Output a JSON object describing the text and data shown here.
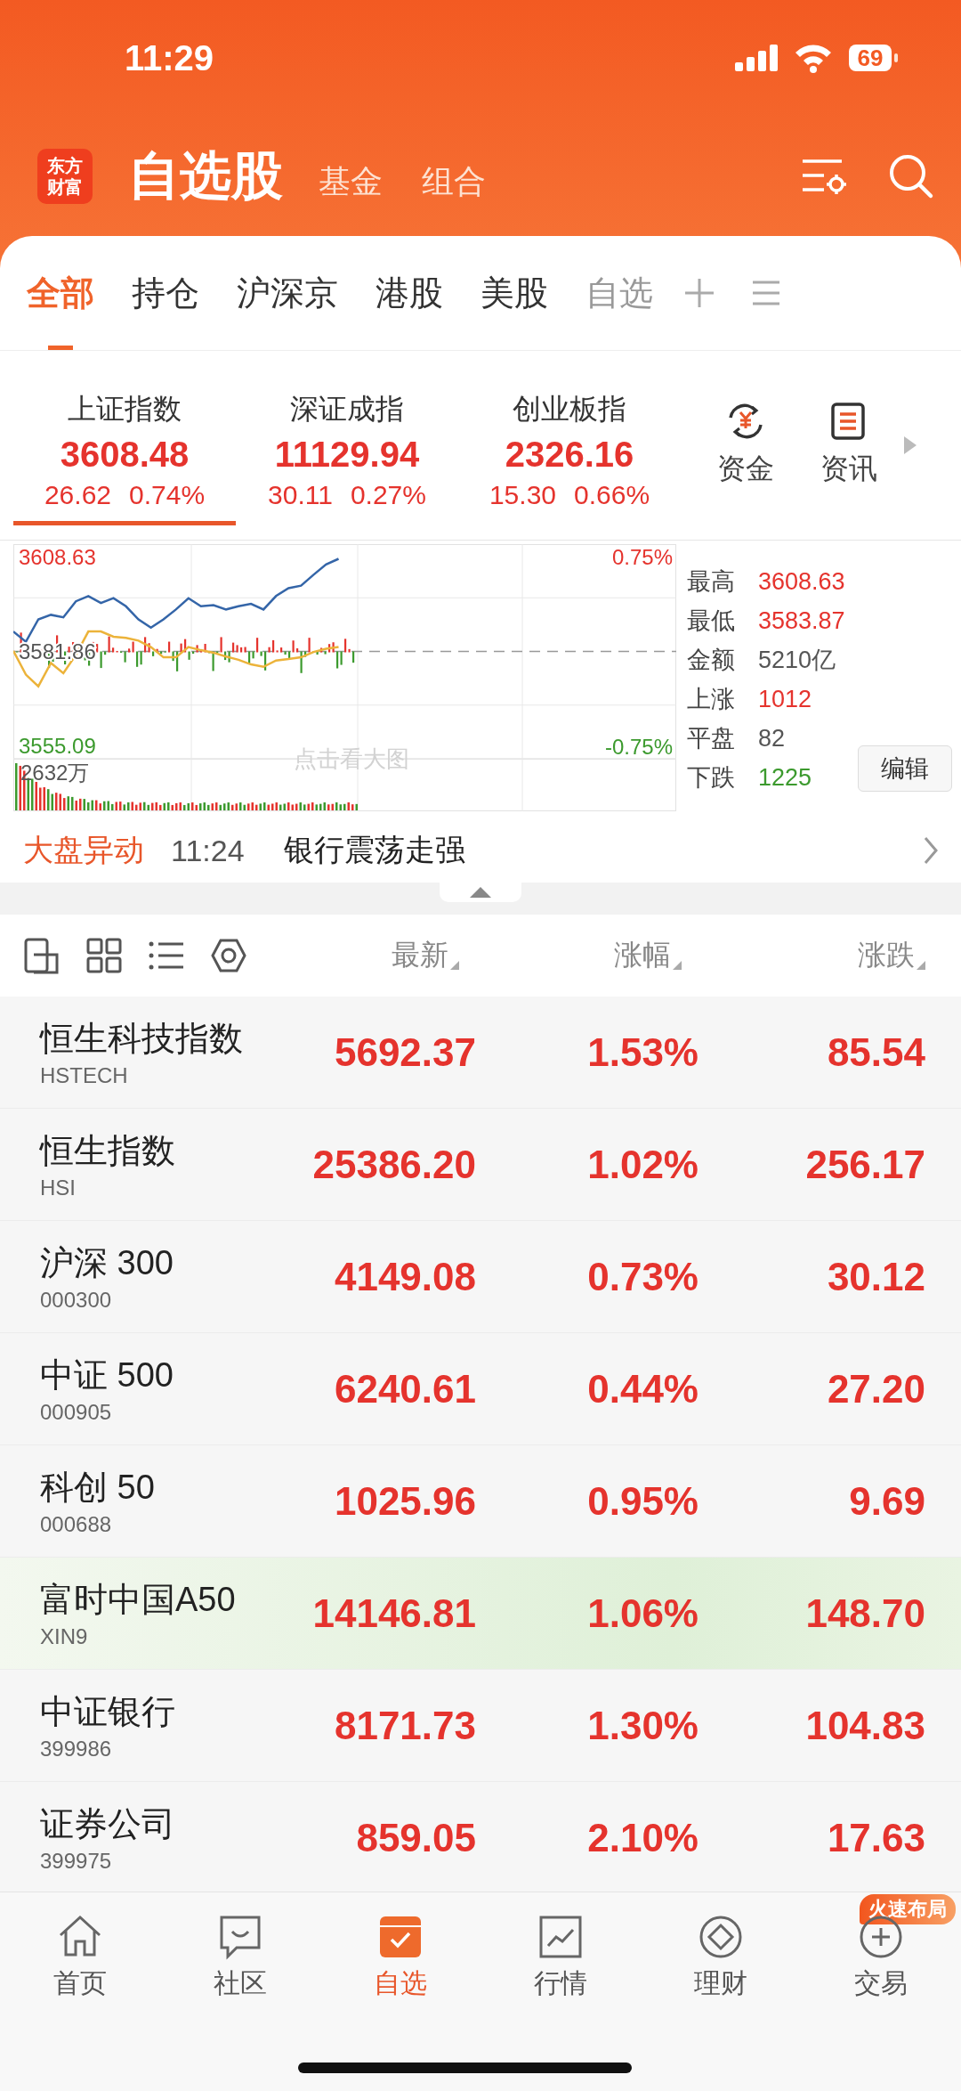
{
  "status_bar": {
    "time": "11:29",
    "battery": "69"
  },
  "header": {
    "logo": [
      "东方",
      "财富"
    ],
    "title": "自选股",
    "links": [
      {
        "label": "基金"
      },
      {
        "label": "组合"
      }
    ]
  },
  "tabs": [
    {
      "label": "全部",
      "selected": true
    },
    {
      "label": "持仓",
      "selected": false
    },
    {
      "label": "沪深京",
      "selected": false
    },
    {
      "label": "港股",
      "selected": false
    },
    {
      "label": "美股",
      "selected": false
    },
    {
      "label": "自选",
      "selected": false
    }
  ],
  "indices": [
    {
      "name": "上证指数",
      "value": "3608.48",
      "change": "26.62",
      "percent": "0.74%",
      "selected": true
    },
    {
      "name": "深证成指",
      "value": "11129.94",
      "change": "30.11",
      "percent": "0.27%",
      "selected": false
    },
    {
      "name": "创业板指",
      "value": "2326.16",
      "change": "15.30",
      "percent": "0.66%",
      "selected": false
    }
  ],
  "shortcuts": [
    {
      "label": "资金",
      "kind": "fund"
    },
    {
      "label": "资讯",
      "kind": "news"
    }
  ],
  "chart": {
    "up_percent": "0.75%",
    "down_percent": "-0.75%",
    "volume_label": "2632万",
    "hint": "点击看大图",
    "chart_data": {
      "type": "line",
      "ylim": [
        3551.57,
        3612.15
      ],
      "yticks": [
        {
          "value": 3555.09,
          "label": "3555.09"
        },
        {
          "value": 3581.86,
          "label": "3581.86"
        },
        {
          "value": 3608.63,
          "label": "3608.63"
        }
      ],
      "categories": [
        null,
        null,
        null,
        null,
        null,
        null,
        null,
        null,
        null,
        null,
        null,
        null,
        null,
        null,
        null,
        null,
        null,
        null,
        null,
        null,
        null,
        null,
        null,
        null,
        null,
        null,
        null,
        null,
        null,
        null,
        null,
        null,
        null,
        null,
        null,
        null,
        null,
        null,
        null,
        null,
        null,
        null,
        null,
        null,
        null,
        null,
        null,
        null,
        null,
        null,
        null,
        null,
        null,
        null
      ],
      "series": [
        {
          "color": "#3465a8",
          "values": [
            3587.5,
            3584.6,
            3590.9,
            3592.2,
            3591.5,
            3596.0,
            3597.5,
            3595.5,
            3596.9,
            3594.6,
            3590.9,
            3588.6,
            3590.9,
            3593.7,
            3596.9,
            3594.6,
            3594.9,
            3593.7,
            3594.6,
            3595.3,
            3593.7,
            3597.5,
            3599.7,
            3600.4,
            3603.5,
            3606.4,
            3608.0,
            null,
            null,
            null,
            null,
            null,
            null,
            null,
            null,
            null,
            null,
            null,
            null,
            null,
            null,
            null,
            null,
            null,
            null,
            null,
            null,
            null,
            null,
            null,
            null,
            null,
            null,
            null
          ]
        },
        {
          "color": "#ecb33a",
          "values": [
            3582.0,
            3575.3,
            3572.0,
            3578.6,
            3575.7,
            3580.9,
            3587.5,
            3587.5,
            3586.0,
            3585.7,
            3584.9,
            3583.1,
            3580.2,
            3580.2,
            3583.1,
            3582.2,
            3581.5,
            3580.4,
            3579.5,
            3578.2,
            3577.5,
            3579.3,
            3579.7,
            3580.2,
            3581.7,
            3582.6,
            3583.1,
            null,
            null,
            null,
            null,
            null,
            null,
            null,
            null,
            null,
            null,
            null,
            null,
            null,
            null,
            null,
            null,
            null,
            null,
            null,
            null,
            null,
            null,
            null,
            null,
            null,
            null,
            null
          ]
        }
      ]
    }
  },
  "stats": [
    {
      "label": "最高",
      "value": "3608.63",
      "color": "#e5332d"
    },
    {
      "label": "最低",
      "value": "3583.87",
      "color": "#e5332d"
    },
    {
      "label": "金额",
      "value": "5210亿",
      "color": "#555555"
    },
    {
      "label": "上涨",
      "value": "1012",
      "color": "#e5332d"
    },
    {
      "label": "平盘",
      "value": "82",
      "color": "#555555"
    },
    {
      "label": "下跌",
      "value": "1225",
      "color": "#3c9a2e"
    }
  ],
  "edit_button": "编辑",
  "alert": {
    "tag": "大盘异动",
    "time": "11:24",
    "text": "银行震荡走强"
  },
  "table": {
    "columns": [
      "最新",
      "涨幅",
      "涨跌"
    ],
    "rows": [
      {
        "name": "恒生科技指数",
        "code": "HSTECH",
        "price": "5692.37",
        "percent": "1.53%",
        "change": "85.54",
        "highlighted": false
      },
      {
        "name": "恒生指数",
        "code": "HSI",
        "price": "25386.20",
        "percent": "1.02%",
        "change": "256.17",
        "highlighted": false
      },
      {
        "name": "沪深 300",
        "code": "000300",
        "price": "4149.08",
        "percent": "0.73%",
        "change": "30.12",
        "highlighted": false
      },
      {
        "name": "中证 500",
        "code": "000905",
        "price": "6240.61",
        "percent": "0.44%",
        "change": "27.20",
        "highlighted": false
      },
      {
        "name": "科创 50",
        "code": "000688",
        "price": "1025.96",
        "percent": "0.95%",
        "change": "9.69",
        "highlighted": false
      },
      {
        "name": "富时中国A50",
        "code": "XIN9",
        "price": "14146.81",
        "percent": "1.06%",
        "change": "148.70",
        "highlighted": true
      },
      {
        "name": "中证银行",
        "code": "399986",
        "price": "8171.73",
        "percent": "1.30%",
        "change": "104.83",
        "highlighted": false
      },
      {
        "name": "证券公司",
        "code": "399975",
        "price": "859.05",
        "percent": "2.10%",
        "change": "17.63",
        "highlighted": false
      }
    ]
  },
  "nav": [
    {
      "label": "首页",
      "kind": "home",
      "selected": false
    },
    {
      "label": "社区",
      "kind": "community",
      "selected": false
    },
    {
      "label": "自选",
      "kind": "watchlist",
      "selected": true
    },
    {
      "label": "行情",
      "kind": "market",
      "selected": false
    },
    {
      "label": "理财",
      "kind": "wealth",
      "selected": false
    },
    {
      "label": "交易",
      "kind": "trade",
      "selected": false,
      "badge": "火速布局"
    }
  ]
}
